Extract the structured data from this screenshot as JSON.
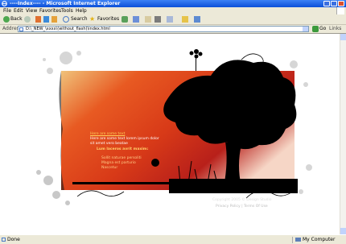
{
  "window": {
    "title": "----Index---- - Microsoft Internet Explorer"
  },
  "menu": [
    "File",
    "Edit",
    "View",
    "Favorites",
    "Tools",
    "Help"
  ],
  "toolbar": {
    "back": "Back",
    "search": "Search",
    "favorites": "Favorites"
  },
  "address": {
    "label": "Address",
    "url": "D:\\_NEW_\\xxxx\\(without_flash)\\index.html",
    "go": "Go",
    "links": "Links"
  },
  "page": {
    "intro_link": "Here are some text",
    "intro_text": "Here are some text lorem ipsum dolor sit amet vero beatae",
    "list_title": "Lum laceros avrit maxim:",
    "list_items": [
      "Sollit naturae persoliti",
      "Magna est parturio",
      "Nascetur"
    ],
    "copyright": "Copyright 2005 © Design Studio",
    "footer_links": "Privacy Policy  |  Terms Of Use"
  },
  "status": {
    "text": "Done",
    "zone": "My Computer"
  }
}
